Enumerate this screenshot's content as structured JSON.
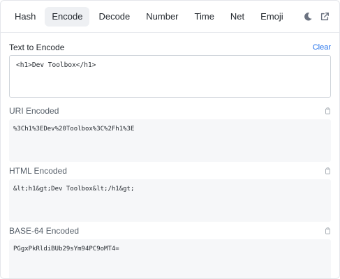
{
  "nav": {
    "tabs": [
      "Hash",
      "Encode",
      "Decode",
      "Number",
      "Time",
      "Net",
      "Emoji"
    ],
    "active": "Encode",
    "icons": [
      "moon-icon",
      "external-link-icon"
    ]
  },
  "input": {
    "label": "Text to Encode",
    "clear_label": "Clear",
    "value": "<h1>Dev Toolbox</h1>"
  },
  "outputs": [
    {
      "label": "URI Encoded",
      "value": "%3Ch1%3EDev%20Toolbox%3C%2Fh1%3E"
    },
    {
      "label": "HTML Encoded",
      "value": "&lt;h1&gt;Dev Toolbox&lt;/h1&gt;"
    },
    {
      "label": "BASE-64 Encoded",
      "value": "PGgxPkRldiBUb29sYm94PC9oMT4="
    }
  ],
  "colors": {
    "accent": "#1f6feb",
    "active_tab_bg": "#eef0f3",
    "output_bg": "#f6f7f9"
  }
}
